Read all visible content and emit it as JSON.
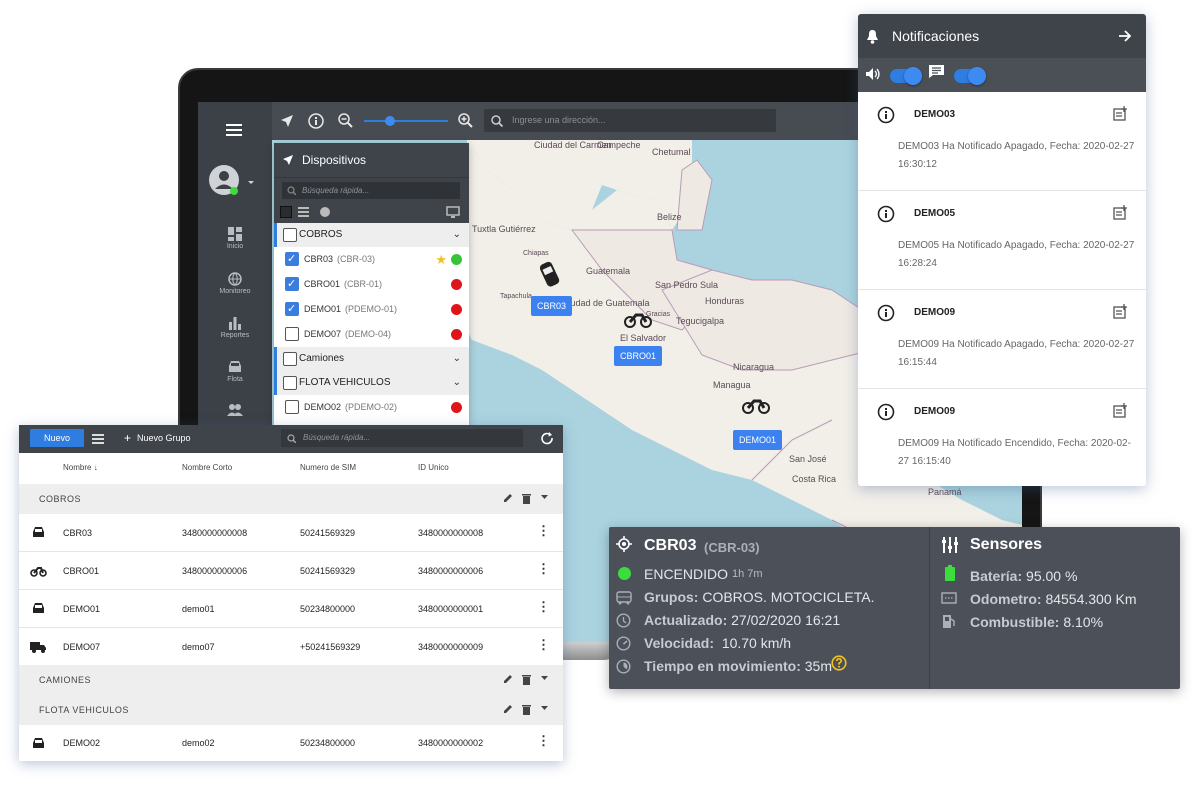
{
  "map_search": {
    "placeholder": "Ingrese una dirección..."
  },
  "rail": {
    "items": [
      {
        "label": "Inicio",
        "icon": "dashboard-icon"
      },
      {
        "label": "Monitoreo",
        "icon": "globe-icon"
      },
      {
        "label": "Reportes",
        "icon": "bar-chart-icon"
      },
      {
        "label": "Flota",
        "icon": "car-icon"
      }
    ]
  },
  "map": {
    "labels": [
      "Ciudad del Carmen",
      "Campeche",
      "Chetumal",
      "Belize",
      "Tuxtla Gutiérrez",
      "Chiapas",
      "Guatemala",
      "San Pedro Sula",
      "Honduras",
      "Tapachula",
      "Ciudad de Guatemala",
      "Tegucigalpa",
      "El Salvador",
      "Gracias",
      "Nicaragua",
      "Managua",
      "San José",
      "Costa Rica",
      "Panamá"
    ],
    "tags": [
      "CBR03",
      "CBRO01",
      "DEMO01"
    ]
  },
  "devices": {
    "title": "Dispositivos",
    "search_placeholder": "Búsqueda rápida...",
    "groups": [
      {
        "name": "COBROS",
        "items": [
          {
            "name": "CBR03",
            "short": "(CBR-03)",
            "checked": true,
            "status": "#38c43a",
            "starred": true
          },
          {
            "name": "CBRO01",
            "short": "(CBR-01)",
            "checked": true,
            "status": "#e0141b"
          },
          {
            "name": "DEMO01",
            "short": "(PDEMO-01)",
            "checked": true,
            "status": "#e0141b"
          },
          {
            "name": "DEMO07",
            "short": "(DEMO-04)",
            "checked": false,
            "status": "#e0141b"
          }
        ]
      },
      {
        "name": "Camiones",
        "items": []
      },
      {
        "name": "FLOTA VEHICULOS",
        "items": [
          {
            "name": "DEMO02",
            "short": "(PDEMO-02)",
            "checked": false,
            "status": "#e0141b"
          }
        ]
      }
    ]
  },
  "notifications": {
    "title": "Notificaciones",
    "items": [
      {
        "device": "DEMO03",
        "message": "DEMO03 Ha Notificado Apagado, Fecha: 2020-02-27 16:30:12"
      },
      {
        "device": "DEMO05",
        "message": "DEMO05 Ha Notificado Apagado, Fecha: 2020-02-27 16:28:24"
      },
      {
        "device": "DEMO09",
        "message": "DEMO09 Ha Notificado Apagado, Fecha: 2020-02-27 16:15:44"
      },
      {
        "device": "DEMO09",
        "message": "DEMO09 Ha Notificado Encendido, Fecha: 2020-02-27 16:15:40"
      }
    ]
  },
  "table": {
    "new_label": "Nuevo",
    "new_group_label": "Nuevo Grupo",
    "search_placeholder": "Búsqueda rápida...",
    "columns": [
      "Nombre",
      "Nombre Corto",
      "Numero de SIM",
      "ID Unico"
    ],
    "groups": [
      {
        "name": "COBROS",
        "rows": [
          {
            "icon": "car-icon",
            "name": "CBR03",
            "short": "3480000000008",
            "sim": "50241569329",
            "id": "3480000000008"
          },
          {
            "icon": "motorcycle-icon",
            "name": "CBRO01",
            "short": "3480000000006",
            "sim": "50241569329",
            "id": "3480000000006"
          },
          {
            "icon": "car-icon",
            "name": "DEMO01",
            "short": "demo01",
            "sim": "50234800000",
            "id": "3480000000001"
          },
          {
            "icon": "truck-icon",
            "name": "DEMO07",
            "short": "demo07",
            "sim": "+50241569329",
            "id": "3480000000009"
          }
        ]
      },
      {
        "name": "CAMIONES",
        "rows": []
      },
      {
        "name": "FLOTA VEHICULOS",
        "rows": [
          {
            "icon": "car-icon",
            "name": "DEMO02",
            "short": "demo02",
            "sim": "50234800000",
            "id": "3480000000002"
          }
        ]
      }
    ]
  },
  "detail": {
    "name": "CBR03",
    "short": "(CBR-03)",
    "status": "ENCENDIDO",
    "duration": "1h 7m",
    "groups_label": "Grupos:",
    "groups_value": "COBROS. MOTOCICLETA.",
    "updated_label": "Actualizado:",
    "updated_value": "27/02/2020 16:21",
    "speed_label": "Velocidad:",
    "speed_value": "10.70 km/h",
    "moving_label": "Tiempo en movimiento:",
    "moving_value": "35m",
    "sensors_title": "Sensores",
    "battery_label": "Batería:",
    "battery_value": "95.00 %",
    "odometer_label": "Odometro:",
    "odometer_value": "84554.300 Km",
    "fuel_label": "Combustible:",
    "fuel_value": "8.10%"
  }
}
